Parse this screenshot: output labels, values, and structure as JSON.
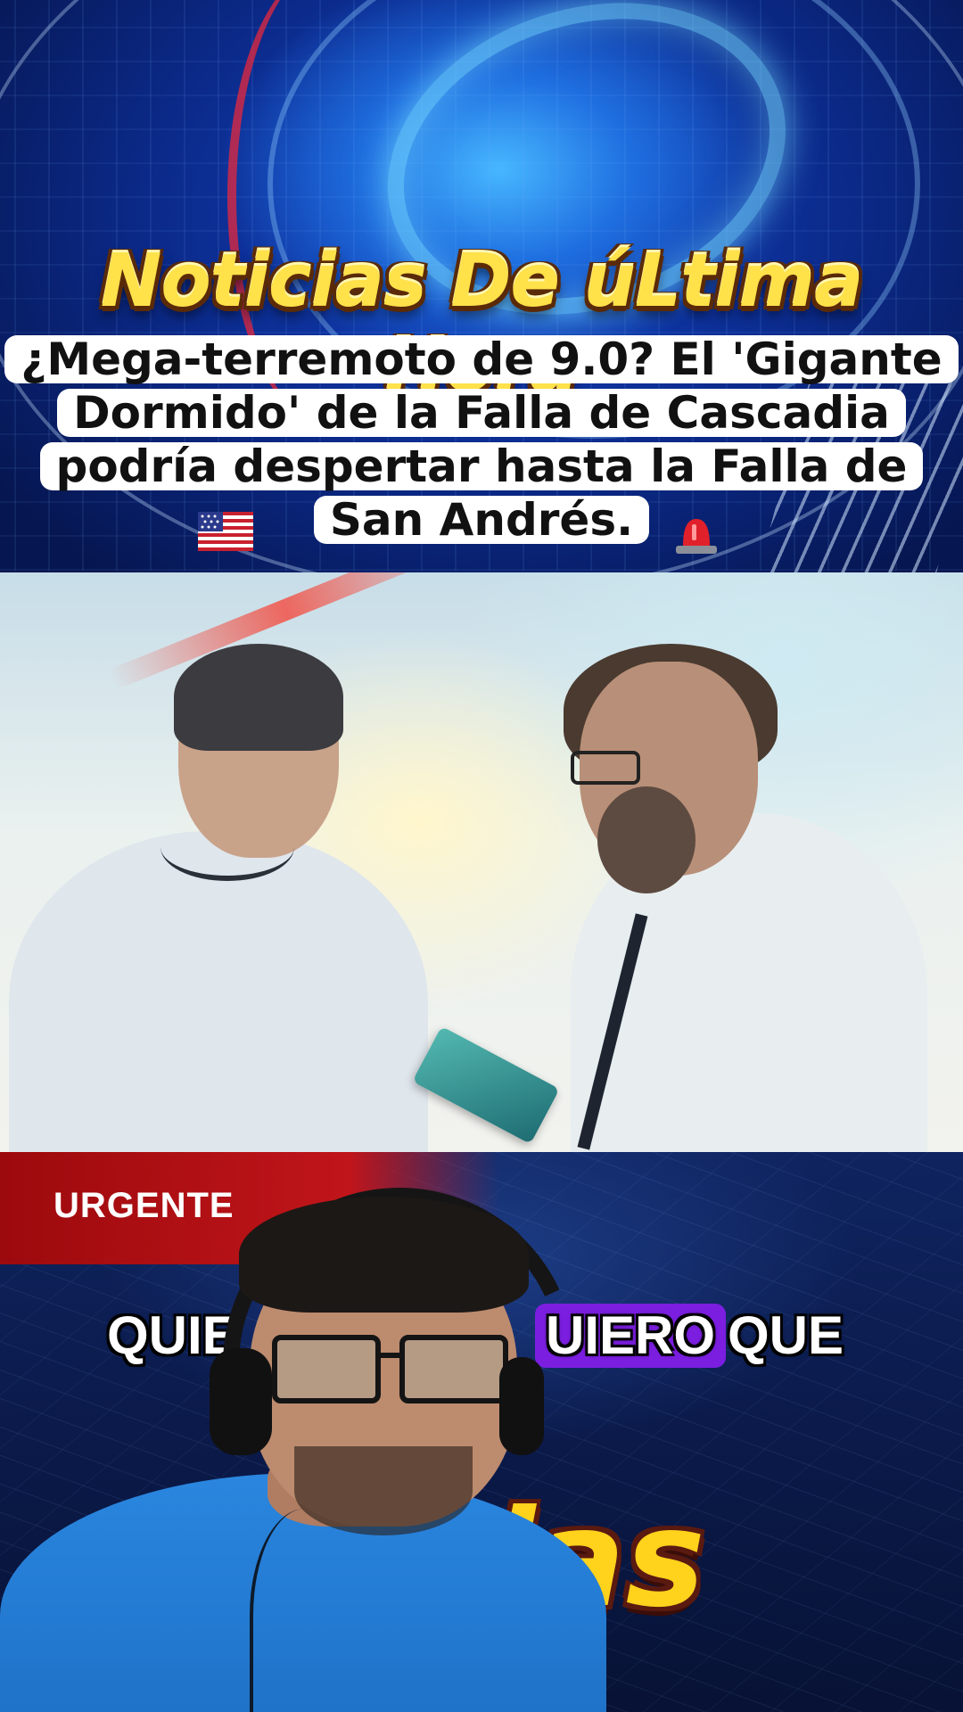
{
  "top_panel": {
    "breaking_title": "Noticias De úLtima Hora",
    "headline_lines": [
      "¿Mega-terremoto de 9.0? El 'Gigante",
      "Dormido' de la Falla de Cascadia",
      "podría despertar hasta la Falla de",
      "San Andrés."
    ],
    "flag_emoji": "🇺🇸",
    "siren_emoji": "🚨"
  },
  "bottom_panel": {
    "urgent_label": "URGENTE",
    "caption_words": [
      "QUIE",
      "UIERO",
      "QUE"
    ],
    "big_word_fragment": "cias"
  },
  "colors": {
    "title_yellow": "#ffe14a",
    "urgent_red": "#c0151a",
    "caption_highlight": "#7b1ee0"
  }
}
